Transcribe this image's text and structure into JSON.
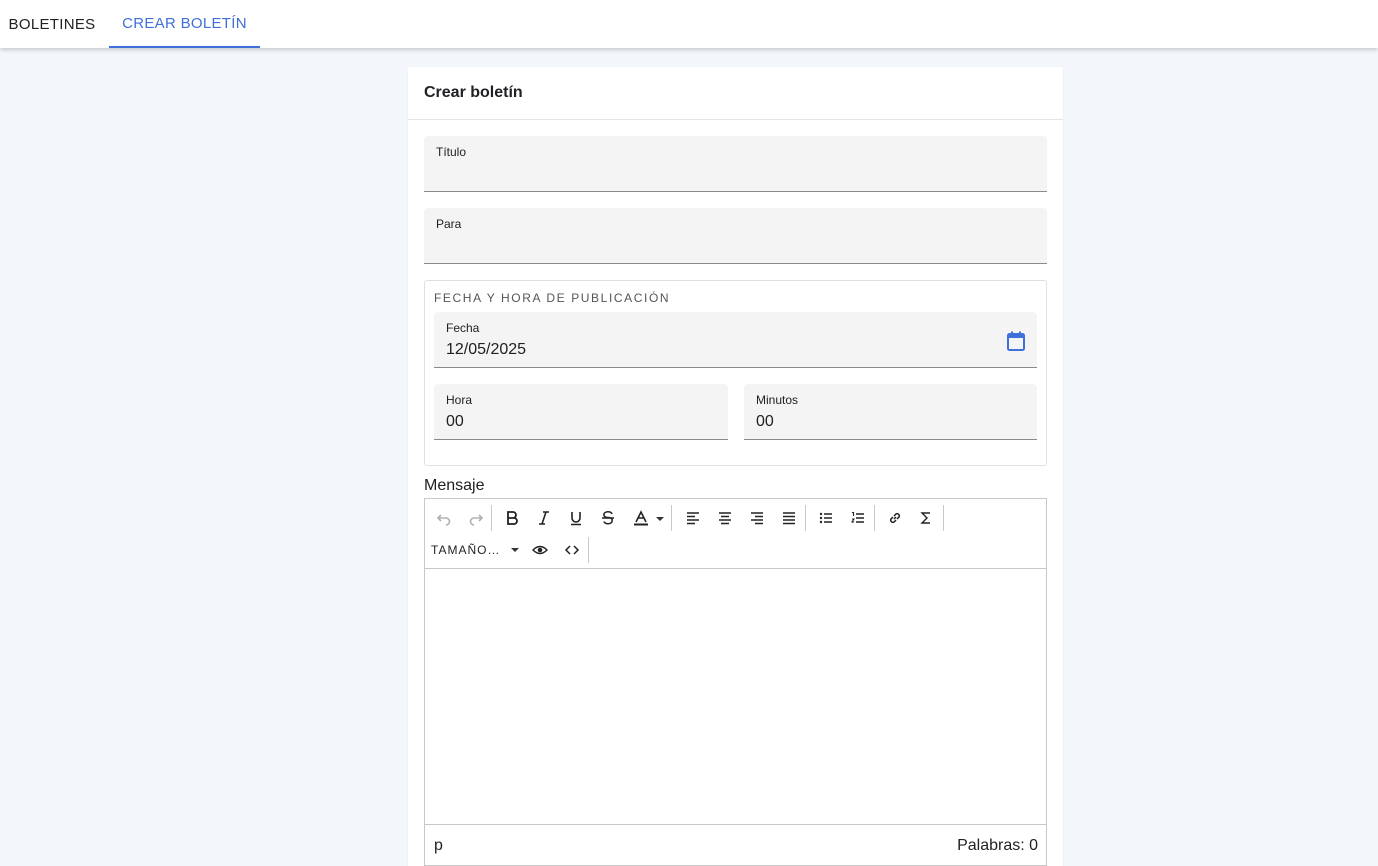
{
  "tabs": {
    "boletines": "BOLETINES",
    "crear": "CREAR BOLETÍN"
  },
  "colors": {
    "accent": "#3f6fd8",
    "background": "#f3f7fb"
  },
  "card": {
    "title": "Crear boletín"
  },
  "form": {
    "titulo_label": "Título",
    "titulo_value": "",
    "para_label": "Para",
    "para_value": "",
    "publication_legend": "FECHA Y HORA DE PUBLICACIÓN",
    "fecha_label": "Fecha",
    "fecha_value": "12/05/2025",
    "hora_label": "Hora",
    "hora_value": "00",
    "minutos_label": "Minutos",
    "minutos_value": "00",
    "mensaje_label": "Mensaje"
  },
  "editor": {
    "toolbar_icons": [
      "undo-icon",
      "redo-icon",
      "bold-icon",
      "italic-icon",
      "underline-icon",
      "strikethrough-icon",
      "text-color-icon",
      "align-left-icon",
      "align-center-icon",
      "align-right-icon",
      "align-justify-icon",
      "bullet-list-icon",
      "numbered-list-icon",
      "link-icon",
      "sigma-icon",
      "preview-eye-icon",
      "code-icon"
    ],
    "font_size_label": "TAMAÑO…",
    "status_path": "p",
    "word_count": "Palabras: 0"
  }
}
